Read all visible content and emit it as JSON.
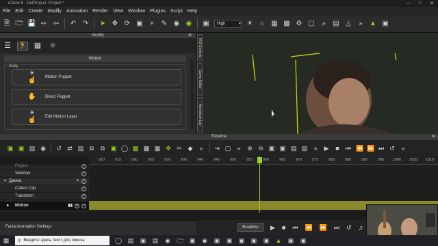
{
  "app": {
    "title": "iClone 8 - DefProject -Project *"
  },
  "menu": [
    "File",
    "Edit",
    "Create",
    "Modify",
    "Animation",
    "Render",
    "View",
    "Window",
    "Plugins",
    "Script",
    "Help"
  ],
  "toolbar": {
    "quality": "High",
    "quality_options_icon": "chevron-down"
  },
  "modify_panel": {
    "title": "Modify",
    "section": "Motion",
    "group": "Body",
    "buttons": [
      {
        "label": "Motion Puppet",
        "icon": "puppet-icon"
      },
      {
        "label": "Direct Puppet",
        "icon": "hand-icon"
      },
      {
        "label": "Edit Motion Layer",
        "icon": "layer-icon"
      }
    ]
  },
  "side_tabs": [
    "IKD Controls",
    "Curve Editor",
    "Animation Lay"
  ],
  "timeline": {
    "title": "Timeline",
    "ruler": [
      "910",
      "915",
      "920",
      "925",
      "930",
      "935",
      "940",
      "945",
      "950",
      "955",
      "960",
      "965",
      "970",
      "975",
      "980",
      "985",
      "990",
      "995",
      "1000",
      "1005",
      "1010"
    ],
    "tracks": [
      {
        "name": "Project",
        "indent": 1
      },
      {
        "name": "Switcher",
        "indent": 1
      },
      {
        "name": "Джина",
        "indent": 0
      },
      {
        "name": "Collect Clip",
        "indent": 1
      },
      {
        "name": "Transform",
        "indent": 1
      },
      {
        "name": "Motion",
        "indent": 1
      }
    ],
    "current_frame": "960"
  },
  "facial": {
    "label": "Facial Animation Settings"
  },
  "playback": {
    "mode": "Realtime",
    "frame": "960"
  },
  "taskbar": {
    "search_placeholder": "Введите здесь текст для поиска"
  },
  "colors": {
    "accent": "#9fd11f",
    "motion_clip": "#8a8a2c"
  }
}
